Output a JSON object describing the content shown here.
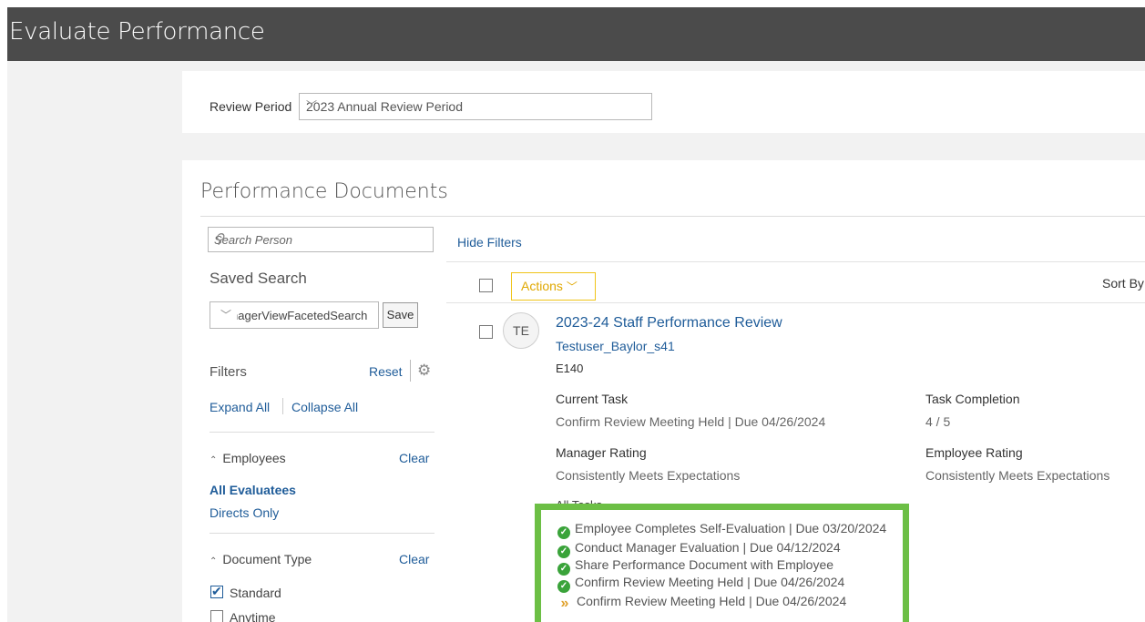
{
  "header": {
    "title": "Evaluate Performance"
  },
  "review_period": {
    "label": "Review Period",
    "value": "2023 Annual Review Period"
  },
  "documents": {
    "title": "Performance Documents",
    "search_placeholder": "Search Person",
    "saved_search": {
      "label": "Saved Search",
      "value": "ManagerViewFacetedSearch",
      "save_label": "Save"
    },
    "filters": {
      "label": "Filters",
      "reset": "Reset",
      "expand_all": "Expand All",
      "collapse_all": "Collapse All",
      "employees": {
        "label": "Employees",
        "clear": "Clear",
        "options": [
          "All Evaluatees",
          "Directs Only"
        ]
      },
      "document_type": {
        "label": "Document Type",
        "clear": "Clear",
        "options": [
          {
            "label": "Standard",
            "checked": true
          },
          {
            "label": "Anytime",
            "checked": false
          }
        ]
      }
    },
    "hide_filters": "Hide Filters",
    "actions_label": "Actions",
    "sort_by": "Sort By",
    "item": {
      "initials": "TE",
      "title": "2023-24 Staff Performance Review",
      "person": "Testuser_Baylor_s41",
      "id": "E140",
      "current_task_label": "Current Task",
      "current_task": "Confirm Review Meeting Held | Due 04/26/2024",
      "task_completion_label": "Task Completion",
      "task_completion": "4 / 5",
      "manager_rating_label": "Manager Rating",
      "manager_rating": "Consistently Meets Expectations",
      "employee_rating_label": "Employee Rating",
      "employee_rating": "Consistently Meets Expectations",
      "all_tasks_label": "All Tasks",
      "tasks": [
        {
          "text": "Employee Completes Self-Evaluation | Due 03/20/2024",
          "status": "complete"
        },
        {
          "text": "Conduct Manager Evaluation | Due 04/12/2024",
          "status": "complete"
        },
        {
          "text": "Share Performance Document with Employee",
          "status": "complete"
        },
        {
          "text": "Confirm Review Meeting Held | Due 04/26/2024",
          "status": "complete"
        },
        {
          "text": "Confirm Review Meeting Held | Due 04/26/2024",
          "status": "current"
        }
      ]
    }
  },
  "colors": {
    "header_bg": "#4b4b4b",
    "link": "#1f5c99",
    "highlight_border": "#6cbf45",
    "complete_icon": "#3aa33a",
    "current_icon": "#e0a12b",
    "actions_accent": "#f0c419"
  },
  "icons": {
    "search": "search-icon",
    "settings": "gear-icon",
    "complete": "check-circle-icon",
    "current": "double-chevron-right-icon"
  }
}
